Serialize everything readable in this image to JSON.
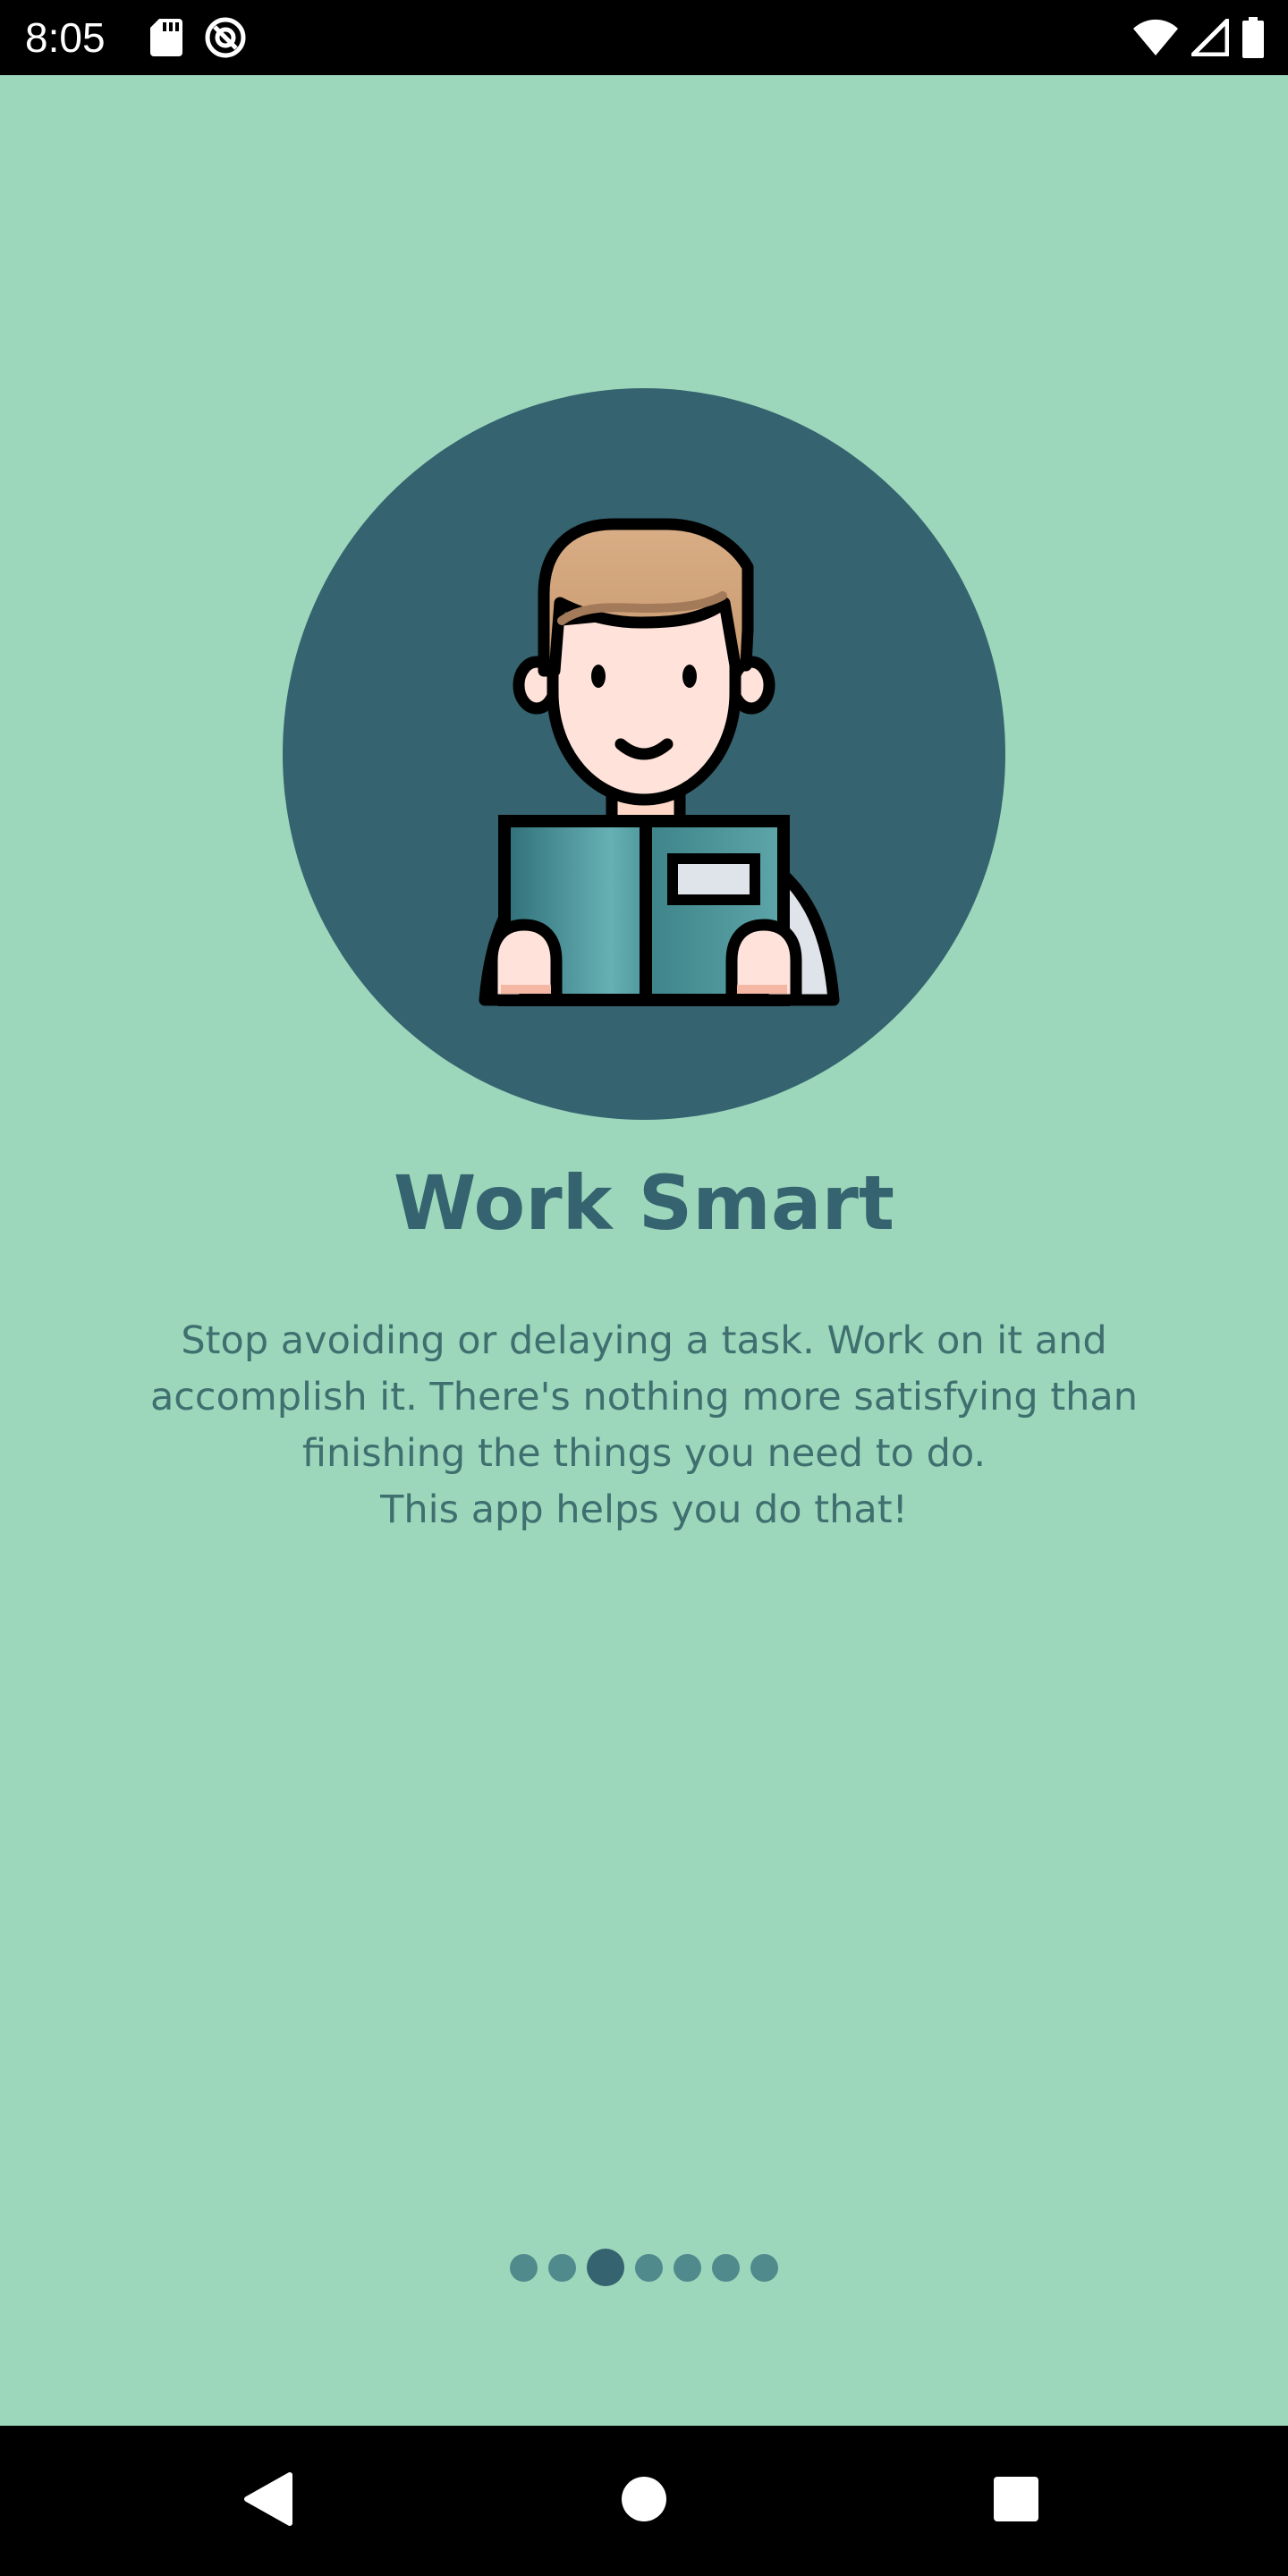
{
  "status_bar": {
    "time": "8:05",
    "left_icons": [
      "sd-card-icon",
      "do-not-disturb-icon"
    ],
    "right_icons": [
      "wifi-icon",
      "cell-signal-icon",
      "battery-icon"
    ]
  },
  "onboarding": {
    "illustration": "person-reading-book-illustration",
    "title": "Work Smart",
    "description": "Stop avoiding or delaying a task. Work on it and\naccomplish it. There's nothing more satisfying than\nfinishing the things you need to do.\nThis app helps you do that!",
    "page_count": 7,
    "current_page": 3
  },
  "nav_bar": {
    "buttons": [
      "back-icon",
      "home-icon",
      "recents-icon"
    ]
  },
  "colors": {
    "background": "#9cd7bc",
    "accent": "#35636f",
    "dot_inactive": "#508a8d",
    "text": "#3f6f6f"
  }
}
